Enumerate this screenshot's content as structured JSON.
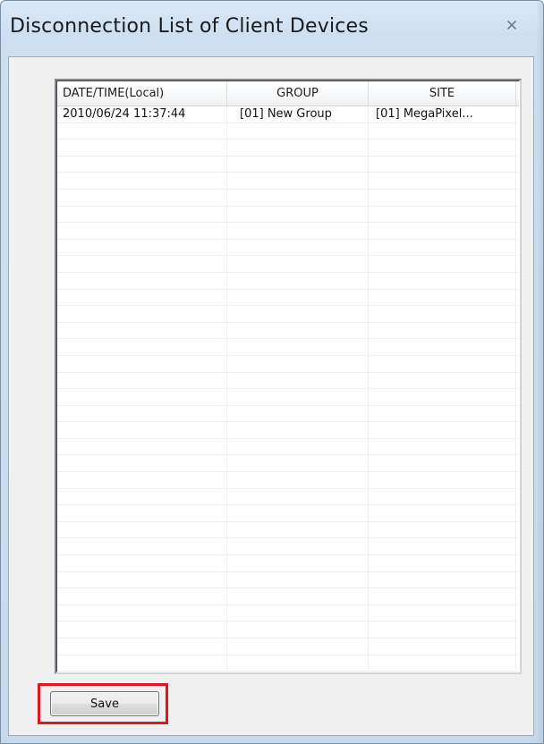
{
  "window": {
    "title": "Disconnection List of Client Devices",
    "close_icon": "close-icon"
  },
  "list": {
    "columns": [
      "DATE/TIME(Local)",
      "GROUP",
      "SITE"
    ],
    "rows": [
      [
        "2010/06/24 11:37:44",
        "[01] New Group",
        "[01] MegaPixel..."
      ]
    ]
  },
  "buttons": {
    "save_label": "Save"
  },
  "colors": {
    "highlight": "#e2161e",
    "frame": "#c6d9ec",
    "client_bg": "#f0f0f0"
  }
}
